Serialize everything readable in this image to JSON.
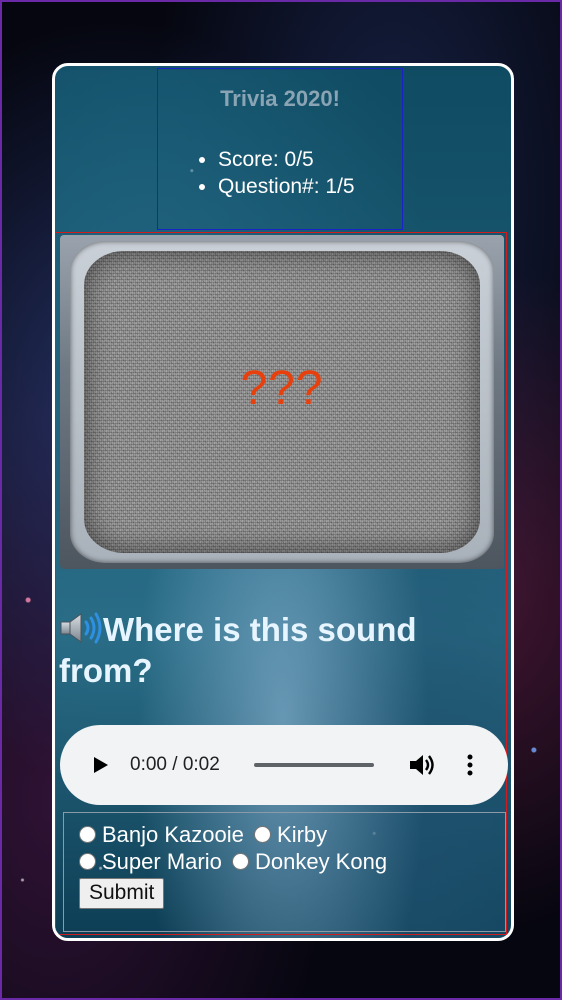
{
  "header": {
    "title": "Trivia 2020!",
    "score": "Score: 0/5",
    "question_number": "Question#: 1/5"
  },
  "screen": {
    "overlay_text": "???",
    "overlay_color": "#e8400c"
  },
  "question": {
    "icon": "speaker-icon",
    "text": "Where is this sound from?"
  },
  "audio_player": {
    "time": "0:00 / 0:02",
    "progress_fraction": 0,
    "icons": [
      "play-icon",
      "volume-icon",
      "more-options-icon"
    ]
  },
  "answers": {
    "options": [
      "Banjo Kazooie",
      "Kirby",
      "Super Mario",
      "Donkey Kong"
    ],
    "submit_label": "Submit"
  },
  "colors": {
    "card_border": "#ffffff",
    "header_border": "#1a23c8",
    "main_border": "#d01c1c",
    "title": "#8aa4b4",
    "question": "#e6f5ff"
  }
}
